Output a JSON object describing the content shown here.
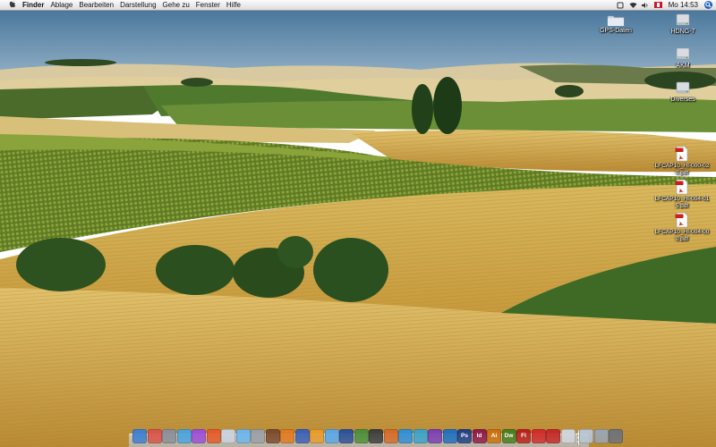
{
  "menubar": {
    "app_name": "Finder",
    "menus": [
      "Ablage",
      "Bearbeiten",
      "Darstellung",
      "Gehe zu",
      "Fenster",
      "Hilfe"
    ],
    "clock": "Mo 14:53",
    "icons": [
      "apple-icon",
      "status-icon",
      "wifi-icon",
      "volume-icon",
      "flag-icon",
      "spotlight-icon"
    ]
  },
  "desktop": {
    "icons": [
      {
        "label": "GPS-Daten",
        "kind": "folder"
      },
      {
        "label": "HDNG-7",
        "kind": "disk"
      },
      {
        "label": "AKM",
        "kind": "disk"
      },
      {
        "label": "Diverses",
        "kind": "disk"
      },
      {
        "label": "LFCAP10_HI-000-020.pdf",
        "kind": "pdf"
      },
      {
        "label": "LFCAP10_HI-004-015.pdf",
        "kind": "pdf"
      },
      {
        "label": "LFCAP10_HI-004-000.pdf",
        "kind": "pdf"
      }
    ]
  },
  "dock": {
    "items": [
      {
        "name": "finder-icon",
        "glyph": "",
        "color": "#3b7fd4"
      },
      {
        "name": "mail-icon",
        "glyph": "",
        "color": "#d8534a"
      },
      {
        "name": "preview-icon",
        "glyph": "",
        "color": "#8a8f99"
      },
      {
        "name": "safari-icon",
        "glyph": "",
        "color": "#4aa3df"
      },
      {
        "name": "itunes-icon",
        "glyph": "",
        "color": "#9c4fd6"
      },
      {
        "name": "photo-icon",
        "glyph": "",
        "color": "#e55a2b"
      },
      {
        "name": "calendar-icon",
        "glyph": "",
        "color": "#c9d3e0"
      },
      {
        "name": "ichat-icon",
        "glyph": "",
        "color": "#6cb6f0"
      },
      {
        "name": "system-preferences-icon",
        "glyph": "",
        "color": "#9aa0a8"
      },
      {
        "name": "dictionary-icon",
        "glyph": "",
        "color": "#7a4a2b"
      },
      {
        "name": "firefox-icon",
        "glyph": "",
        "color": "#e07a1f"
      },
      {
        "name": "network-icon",
        "glyph": "",
        "color": "#3b5fb8"
      },
      {
        "name": "app-icon",
        "glyph": "",
        "color": "#e89b2b"
      },
      {
        "name": "app-icon",
        "glyph": "",
        "color": "#59a7e8"
      },
      {
        "name": "app-icon",
        "glyph": "",
        "color": "#2c4f9a"
      },
      {
        "name": "app-icon",
        "glyph": "",
        "color": "#4b8e3a"
      },
      {
        "name": "app-icon",
        "glyph": "",
        "color": "#3d3d3d"
      },
      {
        "name": "app-icon",
        "glyph": "",
        "color": "#d46b2a"
      },
      {
        "name": "app-icon",
        "glyph": "",
        "color": "#2e8fd6"
      },
      {
        "name": "app-icon",
        "glyph": "",
        "color": "#3ca2c8"
      },
      {
        "name": "app-icon",
        "glyph": "",
        "color": "#7a3fb3"
      },
      {
        "name": "app-icon",
        "glyph": "",
        "color": "#1f6fbf"
      },
      {
        "name": "photoshop-icon",
        "glyph": "Ps",
        "color": "#1f3f86"
      },
      {
        "name": "indesign-icon",
        "glyph": "Id",
        "color": "#8e1a4a"
      },
      {
        "name": "illustrator-icon",
        "glyph": "Ai",
        "color": "#c9700e"
      },
      {
        "name": "dreamweaver-icon",
        "glyph": "Dw",
        "color": "#4a7d1c"
      },
      {
        "name": "flash-icon",
        "glyph": "Fl",
        "color": "#b8211a"
      },
      {
        "name": "acrobat-icon",
        "glyph": "",
        "color": "#cf2a2a"
      },
      {
        "name": "acrobat-reader-icon",
        "glyph": "",
        "color": "#c22828"
      },
      {
        "name": "app-icon",
        "glyph": "",
        "color": "#cfd6de"
      },
      {
        "name": "folder-icon",
        "glyph": "",
        "color": "#b8c6d8"
      },
      {
        "name": "downloads-icon",
        "glyph": "",
        "color": "#9aa6b4"
      },
      {
        "name": "trash-icon",
        "glyph": "",
        "color": "#6d737b"
      }
    ]
  }
}
